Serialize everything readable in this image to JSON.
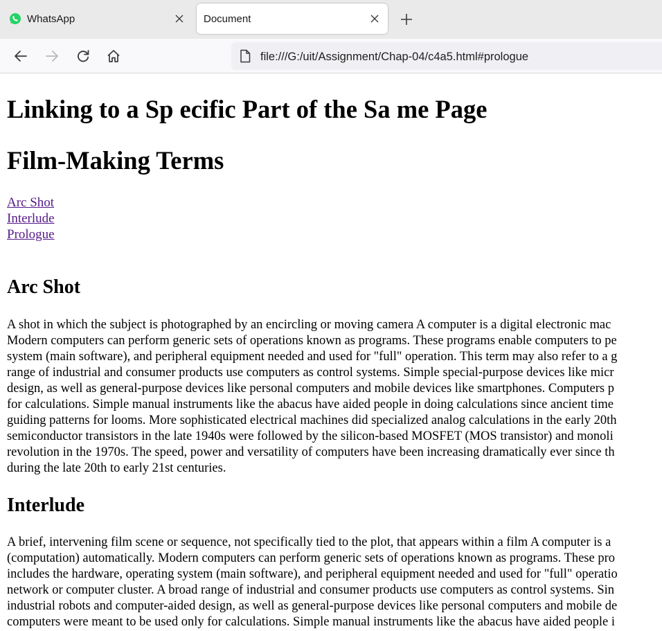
{
  "browser": {
    "tabs": [
      {
        "title": "WhatsApp",
        "icon": "whatsapp-icon",
        "active": false
      },
      {
        "title": "Document",
        "icon": "none",
        "active": true
      }
    ],
    "url": "file:///G:/uit/Assignment/Chap-04/c4a5.html#prologue"
  },
  "page": {
    "heading_main": "Linking to a Sp ecific Part of the Sa me Page",
    "heading_sub": "Film-Making Terms",
    "links": [
      "Arc Shot",
      "Interlude",
      "Prologue"
    ],
    "sections": [
      {
        "title": "Arc Shot",
        "lines": [
          "A shot in which the subject is photographed by an encircling or moving camera A computer is a digital electronic mac",
          "Modern computers can perform generic sets of operations known as programs. These programs enable computers to pe",
          "system (main software), and peripheral equipment needed and used for \"full\" operation. This term may also refer to a g",
          "range of industrial and consumer products use computers as control systems. Simple special-purpose devices like micr",
          "design, as well as general-purpose devices like personal computers and mobile devices like smartphones. Computers p",
          "for calculations. Simple manual instruments like the abacus have aided people in doing calculations since ancient time",
          "guiding patterns for looms. More sophisticated electrical machines did specialized analog calculations in the early 20th",
          "semiconductor transistors in the late 1940s were followed by the silicon-based MOSFET (MOS transistor) and monoli",
          "revolution in the 1970s. The speed, power and versatility of computers have been increasing dramatically ever since th",
          "during the late 20th to early 21st centuries."
        ]
      },
      {
        "title": "Interlude",
        "lines": [
          "A brief, intervening film scene or sequence, not specifically tied to the plot, that appears within a film A computer is a",
          "(computation) automatically. Modern computers can perform generic sets of operations known as programs. These pro",
          "includes the hardware, operating system (main software), and peripheral equipment needed and used for \"full\" operatio",
          "network or computer cluster. A broad range of industrial and consumer products use computers as control systems. Sin",
          "industrial robots and computer-aided design, as well as general-purpose devices like personal computers and mobile de",
          "computers were meant to be used only for calculations. Simple manual instruments like the abacus have aided people i"
        ]
      }
    ]
  },
  "colors": {
    "link_visited": "#551a8b",
    "tabstrip_bg": "#eaeaea",
    "toolbar_bg": "#f9f9fb",
    "urlbar_bg": "#f0f0f4",
    "whatsapp_green": "#25d366"
  }
}
